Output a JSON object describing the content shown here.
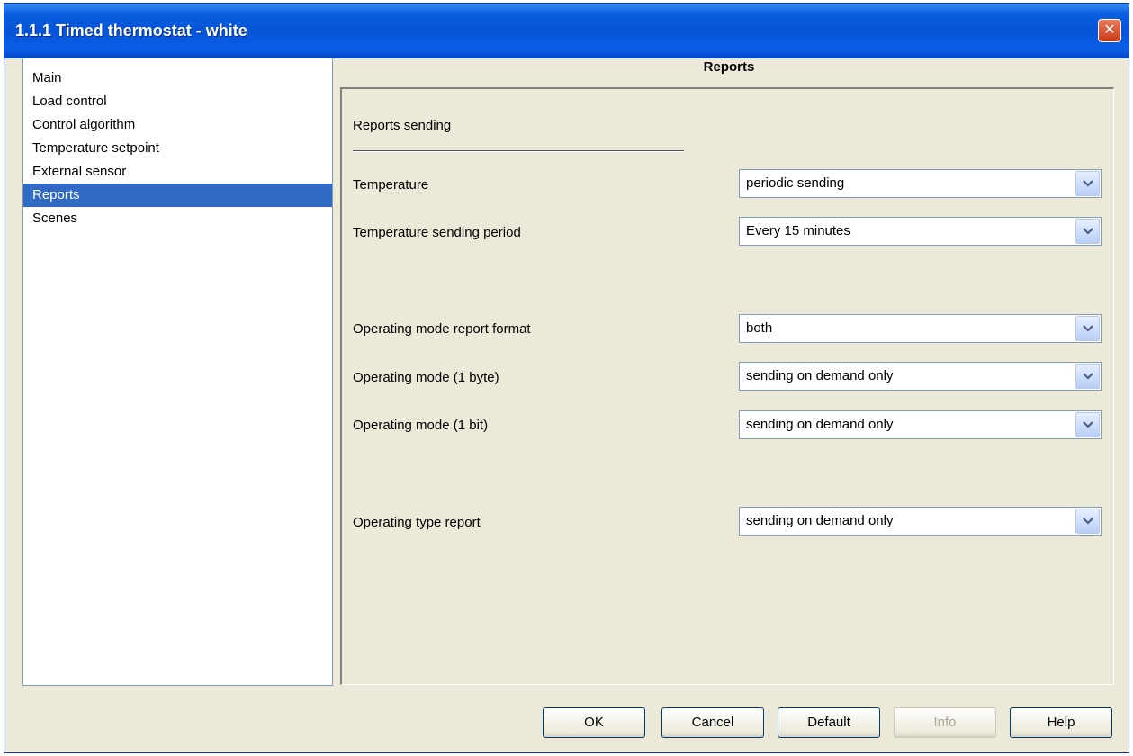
{
  "window": {
    "title": "1.1.1 Timed thermostat - white",
    "close_label": "✕"
  },
  "nav": {
    "items": [
      {
        "label": "Main"
      },
      {
        "label": "Load control"
      },
      {
        "label": "Control algorithm"
      },
      {
        "label": "Temperature setpoint"
      },
      {
        "label": "External sensor"
      },
      {
        "label": "Reports",
        "selected": true
      },
      {
        "label": "Scenes"
      }
    ]
  },
  "page": {
    "title": "Reports",
    "section_heading": "Reports sending",
    "fields": {
      "temperature": {
        "label": "Temperature",
        "value": "periodic sending"
      },
      "temp_period": {
        "label": "Temperature sending period",
        "value": "Every 15 minutes"
      },
      "mode_format": {
        "label": "Operating mode report format",
        "value": "both"
      },
      "mode_byte": {
        "label": "Operating mode (1 byte)",
        "value": "sending on demand only"
      },
      "mode_bit": {
        "label": "Operating mode (1 bit)",
        "value": "sending on demand only"
      },
      "type_report": {
        "label": "Operating type report",
        "value": "sending on demand only"
      }
    }
  },
  "buttons": {
    "ok": "OK",
    "cancel": "Cancel",
    "default": "Default",
    "info": "Info",
    "help": "Help"
  },
  "colors": {
    "selection": "#316ac5",
    "titlebar": "#0654d8",
    "dialog_bg": "#ece9d8"
  },
  "icons": {
    "dropdown": "chevron-down-icon",
    "close": "close-icon"
  }
}
